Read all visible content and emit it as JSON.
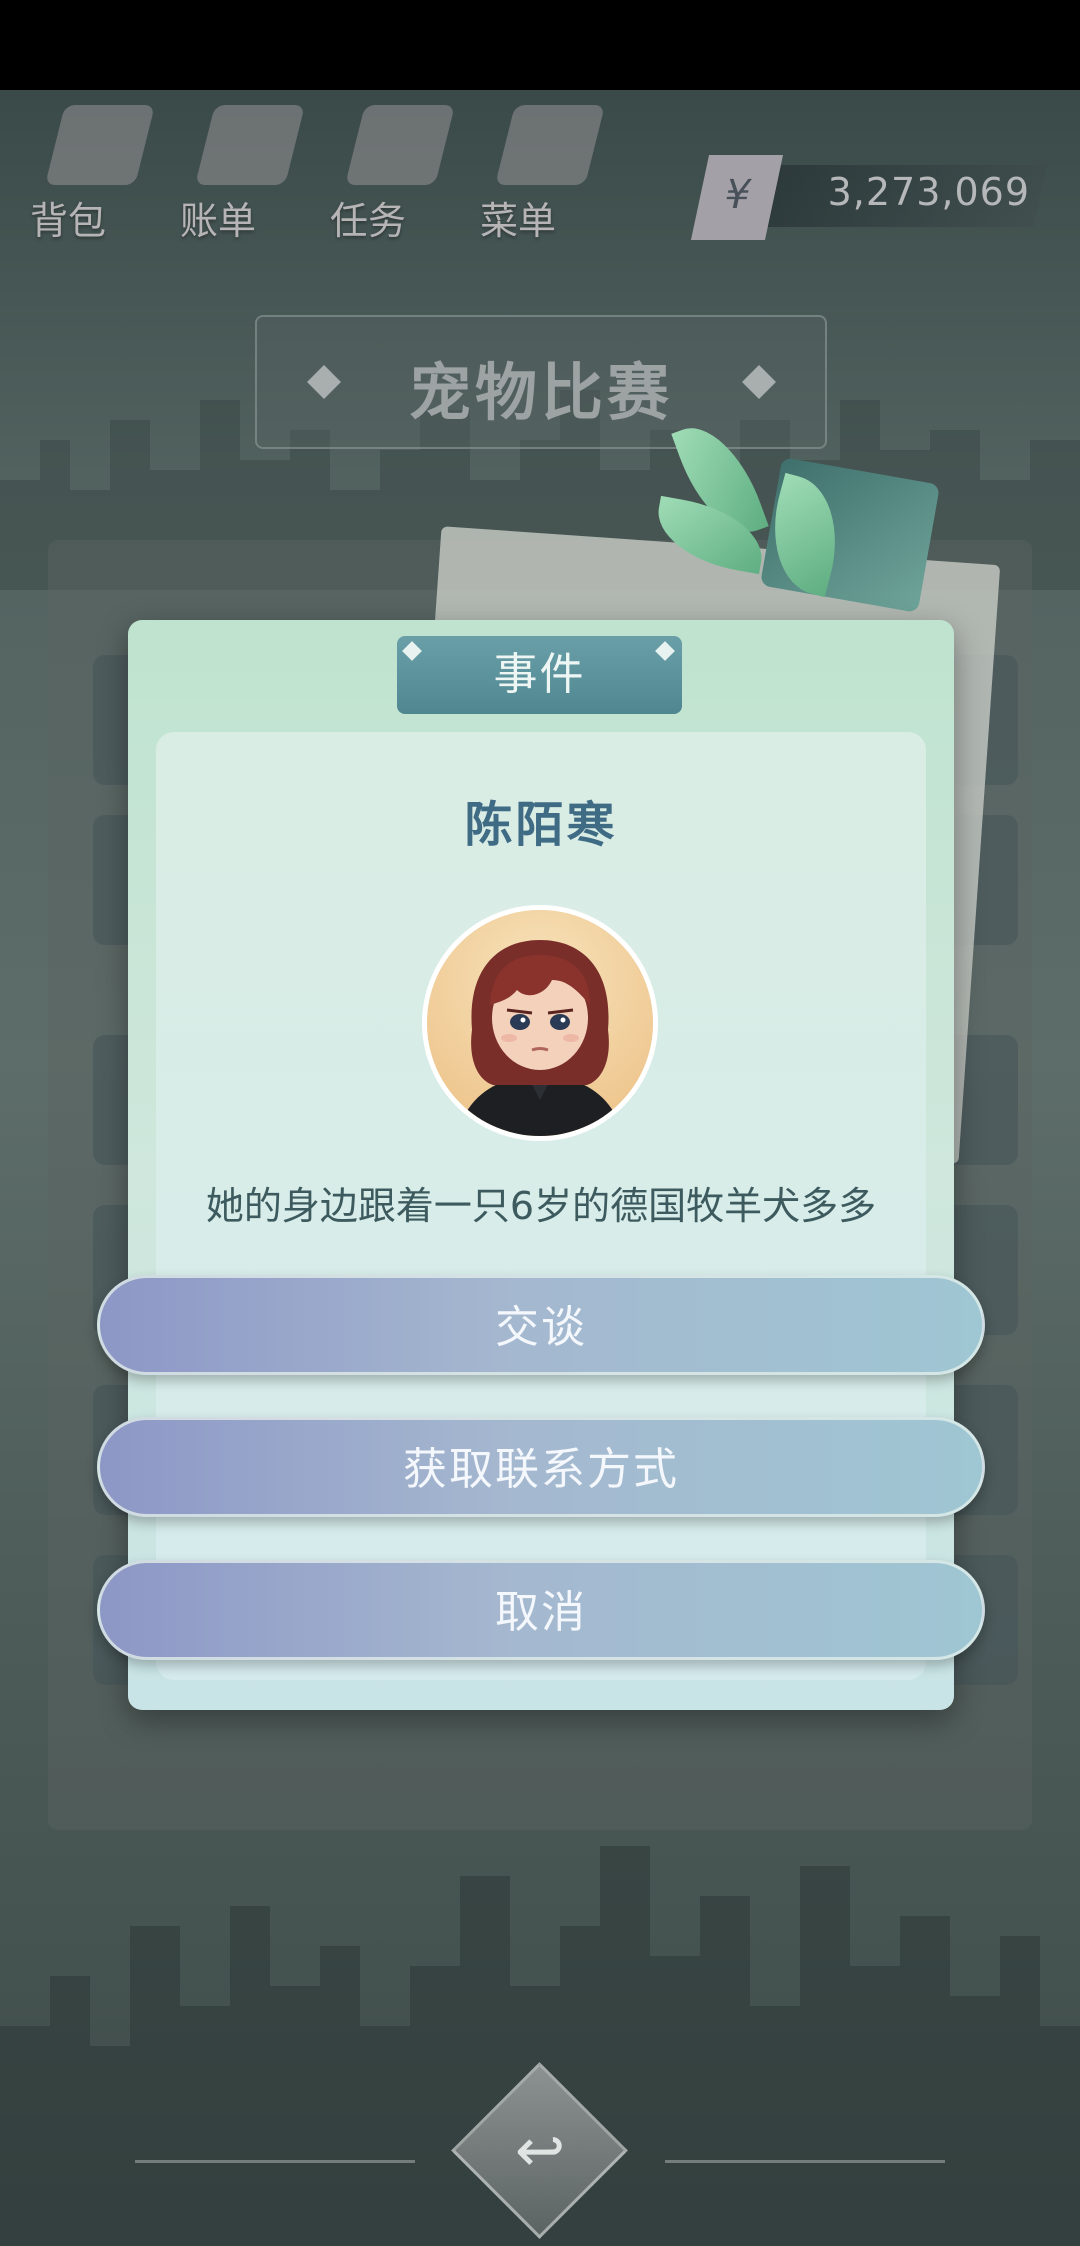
{
  "toolbar": {
    "items": [
      {
        "label": "背包",
        "icon": "backpack-icon"
      },
      {
        "label": "账单",
        "icon": "bill-icon"
      },
      {
        "label": "任务",
        "icon": "task-icon"
      },
      {
        "label": "菜单",
        "icon": "menu-icon"
      }
    ],
    "balance": {
      "currency_symbol": "¥",
      "value": "3,273,069"
    }
  },
  "page": {
    "title": "宠物比赛"
  },
  "dialog": {
    "header": "事件",
    "person_name": "陈陌寒",
    "avatar_icon": "avatar-girl-icon",
    "message": "她的身边跟着一只6岁的德国牧羊犬多多",
    "buttons": {
      "talk": "交谈",
      "get_contact": "获取联系方式",
      "cancel": "取消"
    }
  },
  "footer": {
    "back_icon": "back-arrow-icon"
  },
  "colors": {
    "dialog_bg": "#cfe7dc",
    "header_bg": "#4f8791",
    "name_color": "#3f6b85",
    "button_gradient_start": "#8d97c6",
    "button_gradient_end": "#9fc6d3"
  }
}
